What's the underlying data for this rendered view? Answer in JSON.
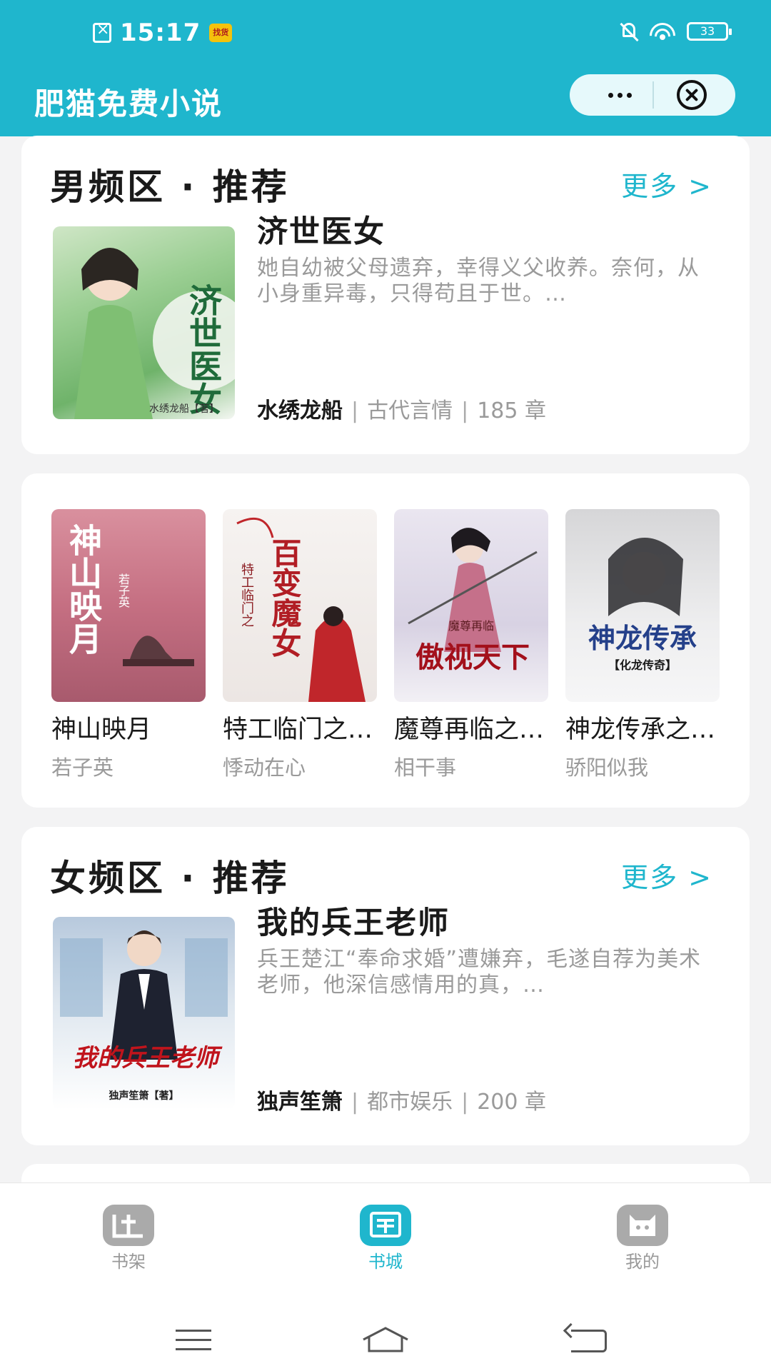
{
  "status_bar": {
    "time": "15:17",
    "app_badge": "找货",
    "battery": "33"
  },
  "header": {
    "title": "肥猫免费小说"
  },
  "male_section": {
    "title": "男频区 · 推荐",
    "more": "更多 >",
    "featured": {
      "name": "济世医女",
      "description": "她自幼被父母遗弃，幸得义父收养。奈何，从小身重异毒，只得苟且于世。…",
      "author": "水绣龙船",
      "genre": "古代言情",
      "chapters": "185 章",
      "cover_title": "济世医女",
      "cover_author": "水绣龙船【著】"
    },
    "grid": [
      {
        "name": "神山映月",
        "author": "若子英",
        "cover_title": "神山映月",
        "cover_sub": "若子英"
      },
      {
        "name": "特工临门之百变魔女",
        "author": "悸动在心",
        "cover_title": "百变魔女",
        "cover_sub": "特工临门之"
      },
      {
        "name": "魔尊再临之傲视天下",
        "author": "相干事",
        "cover_title": "傲视天下",
        "cover_sub": "魔尊再临"
      },
      {
        "name": "神龙传承之化龙传奇",
        "author": "骄阳似我",
        "cover_title": "神龙传承",
        "cover_sub": "【化龙传奇】"
      }
    ]
  },
  "female_section": {
    "title": "女频区 · 推荐",
    "more": "更多 >",
    "featured": {
      "name": "我的兵王老师",
      "description": "兵王楚江“奉命求婚”遭嫌弃，毛遂自荐为美术老师，他深信感情用的真，…",
      "author": "独声笙箫",
      "genre": "都市娱乐",
      "chapters": "200 章",
      "cover_title": "我的兵王老师",
      "cover_author": "独声笙箫【著】"
    }
  },
  "tabbar": [
    {
      "label": "书架",
      "icon": "bookshelf-icon"
    },
    {
      "label": "书城",
      "icon": "bookstore-icon"
    },
    {
      "label": "我的",
      "icon": "profile-icon"
    }
  ],
  "colors": {
    "accent": "#1fb6cd",
    "background": "#f3f3f4"
  }
}
